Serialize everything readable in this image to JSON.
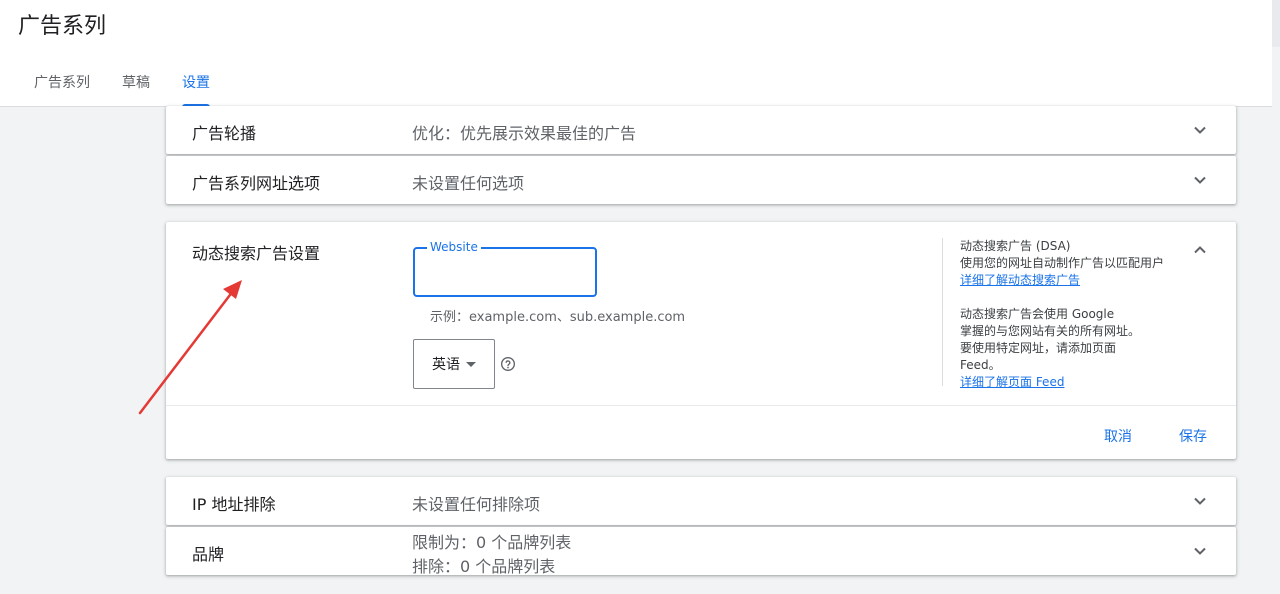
{
  "header": {
    "title": "广告系列",
    "tabs": [
      {
        "label": "广告系列",
        "active": false
      },
      {
        "label": "草稿",
        "active": false
      },
      {
        "label": "设置",
        "active": true
      }
    ]
  },
  "rows": {
    "ad_rotation": {
      "label": "广告轮播",
      "value": "优化：优先展示效果最佳的广告"
    },
    "url_options": {
      "label": "广告系列网址选项",
      "value": "未设置任何选项"
    },
    "ip_exclusion": {
      "label": "IP 地址排除",
      "value": "未设置任何排除项"
    },
    "brand": {
      "label": "品牌",
      "line1": "限制为：0 个品牌列表",
      "line2": "排除：0 个品牌列表"
    }
  },
  "dsa": {
    "title": "动态搜索广告设置",
    "website_label": "Website",
    "website_value": "",
    "example": "示例：example.com、sub.example.com",
    "language": "英语",
    "side": {
      "line1": "动态搜索广告 (DSA)",
      "line2": "使用您的网址自动制作广告以匹配用户",
      "link1": "详细了解动态搜索广告",
      "line3": "动态搜索广告会使用 Google",
      "line4": "掌握的与您网站有关的所有网址。",
      "line5": "要使用特定网址，请添加页面",
      "line6": "Feed。",
      "link2": "详细了解页面 Feed"
    },
    "cancel": "取消",
    "save": "保存"
  },
  "colors": {
    "accent": "#1a73e8",
    "arrow": "#e53935",
    "background": "#f1f3f4"
  }
}
